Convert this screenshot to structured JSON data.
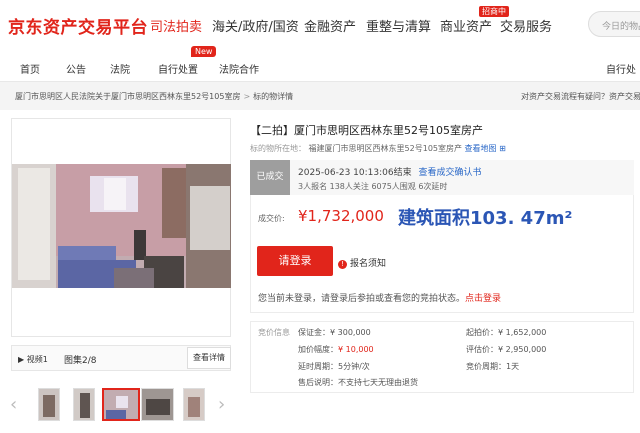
{
  "header": {
    "logo": "京东资产交易平台",
    "categories": [
      "司法拍卖",
      "海关/政府/国资",
      "金融资产",
      "重整与清算",
      "商业资产",
      "交易服务"
    ],
    "category_badge": "招商中",
    "search_placeholder": "今日的物品标"
  },
  "subnav": {
    "items": [
      "首页",
      "公告",
      "法院",
      "自行处置",
      "法院合作"
    ],
    "new_badge": "New",
    "right": "自行处"
  },
  "breadcrumb": {
    "items": [
      "厦门市思明区人民法院关于厦门市思明区西林东里52号105室房",
      "标的物详情"
    ],
    "right": "对资产交易流程有疑问？资产交易"
  },
  "gallery": {
    "video_label": "视频1",
    "gallery_label": "图集2/8",
    "detail_button": "查看详情",
    "prev_arrow": "‹",
    "next_arrow": "›"
  },
  "listing": {
    "title": "【二拍】厦门市思明区西林东里52号105室房产",
    "location_label": "标的物所在地：",
    "location_value": "福建厦门市思明区西林东里52号105室房产",
    "map_link": "查看地图",
    "status": "已成交",
    "end_time": "2025-06-23 10:13:06结束",
    "confirm_link": "查看成交确认书",
    "stats": "3人报名  138人关注  6075人围观  6次延时",
    "price_label": "成交价:",
    "price_value": "¥1,732,000",
    "area_text": "建筑面积103. 47m²",
    "login_button": "请登录",
    "notice_icon": "!",
    "notice_text": "报名须知",
    "login_note": "您当前未登录，请登录后参拍或查看您的竞拍状态。",
    "login_link": "点击登录"
  },
  "details": {
    "section_label": "竞价信息",
    "deposit_label": "保证金：",
    "deposit_value": "¥ 300,000",
    "increment_label": "加价幅度：",
    "increment_value": "¥ 10,000",
    "delay_label": "延时周期：",
    "delay_value": "5分钟/次",
    "aftersale_label": "售后说明：",
    "aftersale_value": "不支持七天无理由退货",
    "start_label": "起拍价：",
    "start_value": "¥ 1,652,000",
    "appraise_label": "评估价：",
    "appraise_value": "¥ 2,950,000",
    "cycle_label": "竞价周期：",
    "cycle_value": "1天"
  },
  "colors": {
    "brand_red": "#e1251b",
    "link_blue": "#2766c7",
    "area_blue": "#2b56b5"
  }
}
